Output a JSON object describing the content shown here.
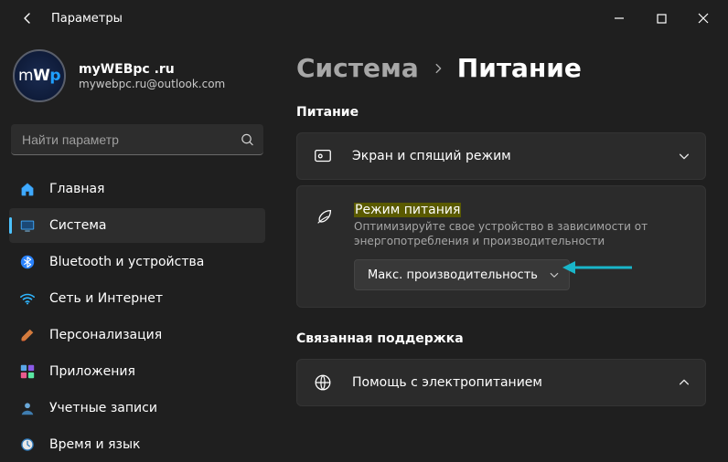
{
  "window": {
    "title": "Параметры"
  },
  "profile": {
    "name": "myWEBpc .ru",
    "email": "mywebpc.ru@outlook.com",
    "avatar_text_parts": [
      "m",
      "W",
      "p"
    ]
  },
  "search": {
    "placeholder": "Найти параметр",
    "value": ""
  },
  "nav": {
    "items": [
      {
        "label": "Главная",
        "icon": "home"
      },
      {
        "label": "Система",
        "icon": "system",
        "active": true
      },
      {
        "label": "Bluetooth и устройства",
        "icon": "bluetooth"
      },
      {
        "label": "Сеть и Интернет",
        "icon": "wifi"
      },
      {
        "label": "Персонализация",
        "icon": "brush"
      },
      {
        "label": "Приложения",
        "icon": "apps"
      },
      {
        "label": "Учетные записи",
        "icon": "person"
      },
      {
        "label": "Время и язык",
        "icon": "clock"
      }
    ]
  },
  "breadcrumb": {
    "root": "Система",
    "current": "Питание"
  },
  "section_power_title": "Питание",
  "card_screen_sleep": {
    "title": "Экран и спящий режим"
  },
  "card_power_mode": {
    "title": "Режим питания",
    "subtitle": "Оптимизируйте свое устройство в зависимости от энергопотребления и производительности",
    "dropdown_value": "Макс. производительность"
  },
  "section_support_title": "Связанная поддержка",
  "card_help": {
    "title": "Помощь с электропитанием"
  },
  "icons": {
    "home": "home",
    "system": "system",
    "bluetooth": "bluetooth",
    "wifi": "wifi",
    "brush": "brush",
    "apps": "apps",
    "person": "person",
    "clock": "clock",
    "screen": "screen",
    "leaf": "leaf",
    "globe": "globe"
  },
  "colors": {
    "accent": "#4cc2ff",
    "arrow": "#19b6c9"
  }
}
